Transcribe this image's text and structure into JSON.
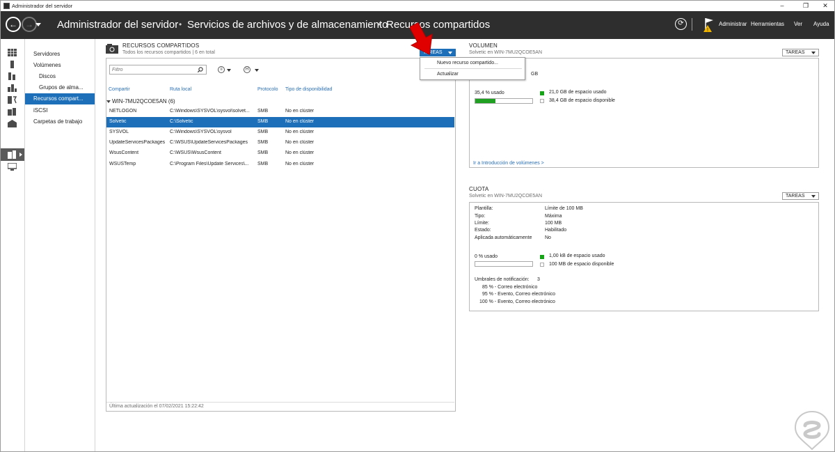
{
  "window": {
    "title": "Administrador del servidor",
    "minimize": "–",
    "restore": "❐",
    "close": "✕"
  },
  "header": {
    "back": "←",
    "forward": "→",
    "breadcrumb": [
      "Administrador del servidor",
      "Servicios de archivos y de almacenamiento",
      "Recursos compartidos"
    ],
    "separator": "•",
    "refresh": "⟳",
    "menu": [
      "Administrar",
      "Herramientas",
      "Ver",
      "Ayuda"
    ]
  },
  "rail_icons": [
    "dashboard-icon",
    "local-server-icon",
    "all-servers-icon",
    "ad-icon",
    "dns-icon",
    "file-services-icon",
    "iis-icon",
    "storage-icon",
    "wsus-icon"
  ],
  "nav": {
    "items": [
      "Servidores",
      "Volúmenes",
      "Discos",
      "Grupos de alma...",
      "Recursos compart...",
      "iSCSI",
      "Carpetas de trabajo"
    ]
  },
  "shares": {
    "title": "RECURSOS COMPARTIDOS",
    "subtitle": "Todos los recursos compartidos | 6 en total",
    "tasks_label": "TAREAS",
    "filter_placeholder": "Filtro",
    "view_btn": "≡",
    "group_btn": "H",
    "columns": [
      "Compartir",
      "Ruta local",
      "Protocolo",
      "Tipo de disponibilidad"
    ],
    "group": "WIN-7MU2QCOE5AN (6)",
    "rows": [
      [
        "NETLOGON",
        "C:\\Windows\\SYSVOL\\sysvol\\solvet...",
        "SMB",
        "No en clúster"
      ],
      [
        "Solvetic",
        "C:\\Solvetic",
        "SMB",
        "No en clúster"
      ],
      [
        "SYSVOL",
        "C:\\Windows\\SYSVOL\\sysvol",
        "SMB",
        "No en clúster"
      ],
      [
        "UpdateServicesPackages",
        "C:\\WSUS\\UpdateServicesPackages",
        "SMB",
        "No en clúster"
      ],
      [
        "WsusContent",
        "C:\\WSUS\\WsusContent",
        "SMB",
        "No en clúster"
      ],
      [
        "WSUSTemp",
        "C:\\Program Files\\Update Services\\...",
        "SMB",
        "No en clúster"
      ]
    ],
    "status": "Última actualización el 07/02/2021 15:22:42"
  },
  "dropdown": {
    "items": [
      "Nuevo recurso compartido...",
      "Actualizar"
    ]
  },
  "volume": {
    "title": "VOLUMEN",
    "subtitle": "Solvetic en WIN-7MU2QCOE5AN",
    "tasks_label": "TAREAS",
    "capacity_partial": "GB",
    "used_pct_label": "35,4 % usado",
    "used_fraction": 0.354,
    "used_label": "21,0 GB de espacio usado",
    "free_label": "38,4 GB de espacio disponible",
    "link": "Ir a Introducción de volúmenes >"
  },
  "quota": {
    "title": "CUOTA",
    "subtitle": "Solvetic en WIN-7MU2QCOE5AN",
    "tasks_label": "TAREAS",
    "props": [
      [
        "Plantilla:",
        "Límite de 100 MB"
      ],
      [
        "Tipo:",
        "Máxima"
      ],
      [
        "Límite:",
        "100 MB"
      ],
      [
        "Estado:",
        "Habilitado"
      ],
      [
        "Aplicada automáticamente",
        "No"
      ]
    ],
    "used_pct_label": "0 % usado",
    "used_fraction": 0.0,
    "used_label": "1,00 kB de espacio usado",
    "free_label": "100 MB de espacio disponible",
    "thresholds_label": "Umbrales de notificación:",
    "thresholds_count": "3",
    "thresholds": [
      "85 % - Correo electrónico",
      "95 % - Evento, Correo electrónico",
      "100 % - Evento, Correo electrónico"
    ]
  },
  "colors": {
    "header_bg": "#2e2e2e",
    "accent": "#1c6fb8",
    "used": "#17a317",
    "link": "#2a6fb5",
    "arrow": "#e00000"
  }
}
